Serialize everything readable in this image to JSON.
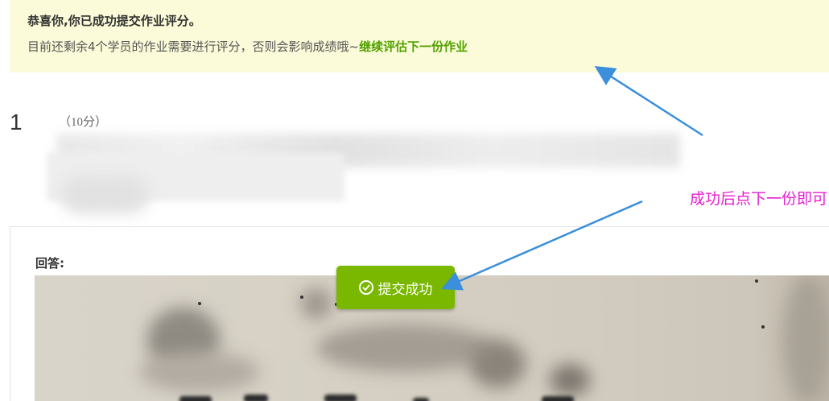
{
  "notice": {
    "title": "恭喜你,你已成功提交作业评分。",
    "message": "目前还剩余4个学员的作业需要进行评分，否则会影响成绩哦~",
    "next_link": "继续评估下一份作业"
  },
  "question": {
    "number": "1",
    "score": "（10分）"
  },
  "answer": {
    "label": "回答:"
  },
  "submit_button": {
    "icon": "check-circle-icon",
    "label": "提交成功"
  },
  "annotation": {
    "text": "成功后点下一份即可",
    "color": "#e81ed0",
    "arrow_color": "#3b8fdb"
  },
  "colors": {
    "notice_bg": "#fbfbd9",
    "link_green": "#53a100",
    "button_green": "#7ab800"
  }
}
